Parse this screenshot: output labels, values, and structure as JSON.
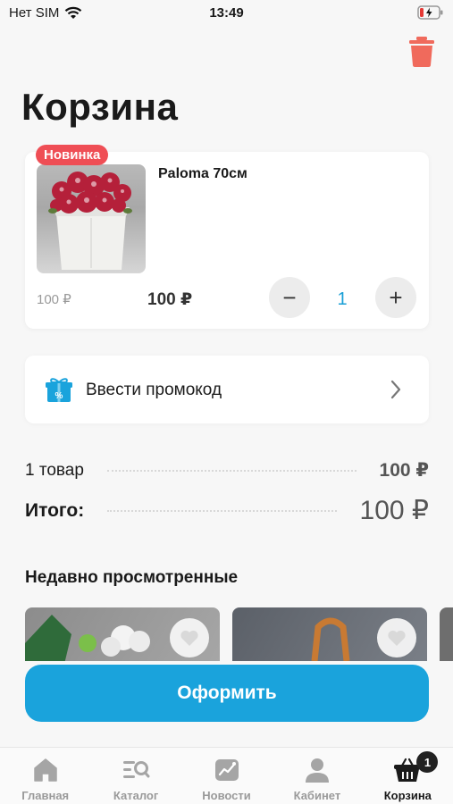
{
  "status_bar": {
    "carrier": "Нет SIM",
    "time": "13:49"
  },
  "header": {
    "title": "Корзина"
  },
  "cart_item": {
    "badge": "Новинка",
    "name": "Paloma 70см",
    "old_price": "100 ₽",
    "price": "100 ₽",
    "quantity": "1",
    "minus": "−",
    "plus": "+"
  },
  "promo": {
    "label": "Ввести промокод"
  },
  "summary": {
    "count_label": "1 товар",
    "count_amount": "100 ₽",
    "total_label": "Итого:",
    "total_amount": "100 ₽"
  },
  "recent": {
    "title": "Недавно просмотренные"
  },
  "checkout": {
    "label": "Оформить"
  },
  "tab_bar": {
    "tabs": [
      {
        "label": "Главная",
        "icon": "home-icon"
      },
      {
        "label": "Каталог",
        "icon": "catalog-icon"
      },
      {
        "label": "Новости",
        "icon": "news-icon"
      },
      {
        "label": "Кабинет",
        "icon": "profile-icon"
      },
      {
        "label": "Корзина",
        "icon": "basket-icon",
        "badge": "1",
        "active": true
      }
    ]
  },
  "colors": {
    "accent": "#1aa3dc",
    "badge_red": "#ef4e55",
    "trash": "#f06a5c"
  }
}
